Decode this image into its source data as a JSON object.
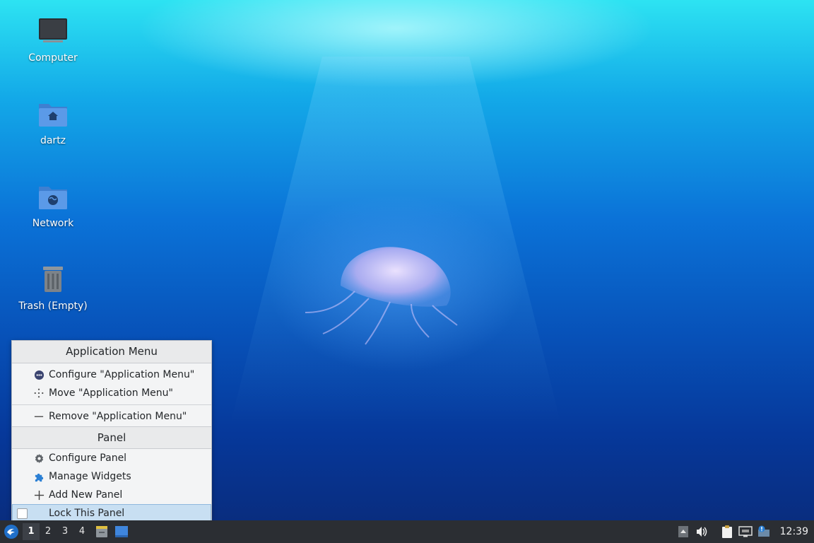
{
  "desktop": {
    "icons": [
      {
        "label": "Computer"
      },
      {
        "label": "dartz"
      },
      {
        "label": "Network"
      },
      {
        "label": "Trash (Empty)"
      }
    ]
  },
  "context_menu": {
    "section1_title": "Application Menu",
    "items1": [
      {
        "label": "Configure \"Application Menu\"",
        "icon": "settings-round-icon"
      },
      {
        "label": "Move \"Application Menu\"",
        "icon": "move-icon"
      },
      {
        "label": "Remove \"Application Menu\"",
        "icon": "remove-icon"
      }
    ],
    "section2_title": "Panel",
    "items2": [
      {
        "label": "Configure Panel",
        "icon": "gear-icon"
      },
      {
        "label": "Manage Widgets",
        "icon": "puzzle-icon"
      },
      {
        "label": "Add New Panel",
        "icon": "plus-icon"
      },
      {
        "label": "Lock This Panel",
        "icon": "checkbox"
      }
    ]
  },
  "taskbar": {
    "workspaces": [
      "1",
      "2",
      "3",
      "4"
    ],
    "active_workspace": "1",
    "clock": "12:39"
  },
  "colors": {
    "panel_bg": "#2b2e33",
    "menu_bg": "#f3f4f5",
    "highlight": "#c8dff2"
  }
}
